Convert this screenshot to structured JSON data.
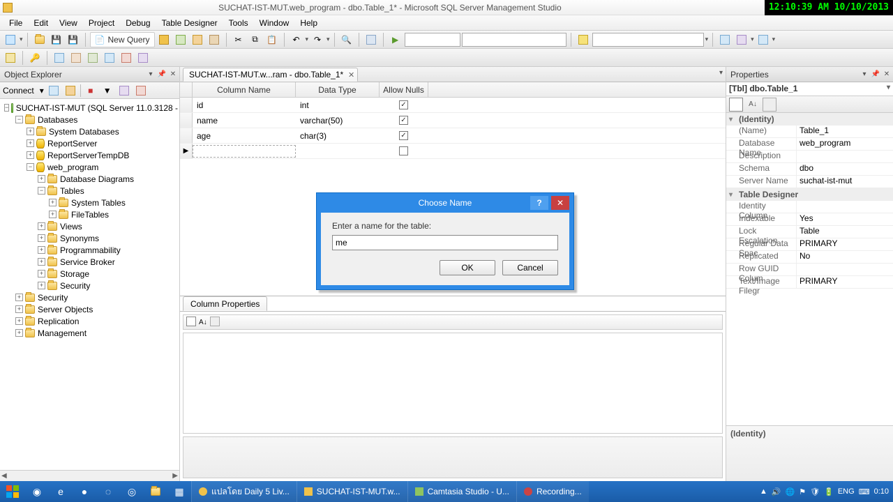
{
  "title": "SUCHAT-IST-MUT.web_program - dbo.Table_1* - Microsoft SQL Server Management Studio",
  "clock": "12:10:39 AM 10/10/2013",
  "menu": [
    "File",
    "Edit",
    "View",
    "Project",
    "Debug",
    "Table Designer",
    "Tools",
    "Window",
    "Help"
  ],
  "toolbar": {
    "newquery": "New Query"
  },
  "objectExplorer": {
    "title": "Object Explorer",
    "connect": "Connect",
    "root": "SUCHAT-IST-MUT (SQL Server 11.0.3128 -",
    "databases": "Databases",
    "sysdb": "System Databases",
    "rs": "ReportServer",
    "rst": "ReportServerTempDB",
    "wp": "web_program",
    "dbdiag": "Database Diagrams",
    "tables": "Tables",
    "systables": "System Tables",
    "filetables": "FileTables",
    "views": "Views",
    "synonyms": "Synonyms",
    "prog": "Programmability",
    "sb": "Service Broker",
    "storage": "Storage",
    "security": "Security",
    "rootsec": "Security",
    "srvobj": "Server Objects",
    "repl": "Replication",
    "mgmt": "Management"
  },
  "docTab": "SUCHAT-IST-MUT.w...ram - dbo.Table_1*",
  "grid": {
    "headers": {
      "c1": "Column Name",
      "c2": "Data Type",
      "c3": "Allow Nulls"
    },
    "rows": [
      {
        "name": "id",
        "type": "int",
        "null": true
      },
      {
        "name": "name",
        "type": "varchar(50)",
        "null": true
      },
      {
        "name": "age",
        "type": "char(3)",
        "null": true
      }
    ]
  },
  "columnProps": "Column Properties",
  "dialog": {
    "title": "Choose Name",
    "label": "Enter a name for the table:",
    "value": "me",
    "ok": "OK",
    "cancel": "Cancel"
  },
  "properties": {
    "title": "Properties",
    "objname": "[Tbl] dbo.Table_1",
    "cat1": "(Identity)",
    "name_k": "(Name)",
    "name_v": "Table_1",
    "dbname_k": "Database Name",
    "dbname_v": "web_program",
    "desc_k": "Description",
    "desc_v": "",
    "schema_k": "Schema",
    "schema_v": "dbo",
    "server_k": "Server Name",
    "server_v": "suchat-ist-mut",
    "cat2": "Table Designer",
    "idcol_k": "Identity Column",
    "idcol_v": "",
    "index_k": "Indexable",
    "index_v": "Yes",
    "lock_k": "Lock Escalation",
    "lock_v": "Table",
    "rds_k": "Regular Data Spac",
    "rds_v": "PRIMARY",
    "repl_k": "Replicated",
    "repl_v": "No",
    "guid_k": "Row GUID Colum",
    "guid_v": "",
    "tif_k": "Text/Image Filegr",
    "tif_v": "PRIMARY",
    "desc": "(Identity)"
  },
  "taskbar": {
    "items": [
      {
        "label": "แปลโดย Daily 5 Liv..."
      },
      {
        "label": "SUCHAT-IST-MUT.w..."
      },
      {
        "label": "Camtasia Studio - U..."
      },
      {
        "label": "Recording..."
      }
    ],
    "lang": "ENG",
    "time": "0:10"
  }
}
